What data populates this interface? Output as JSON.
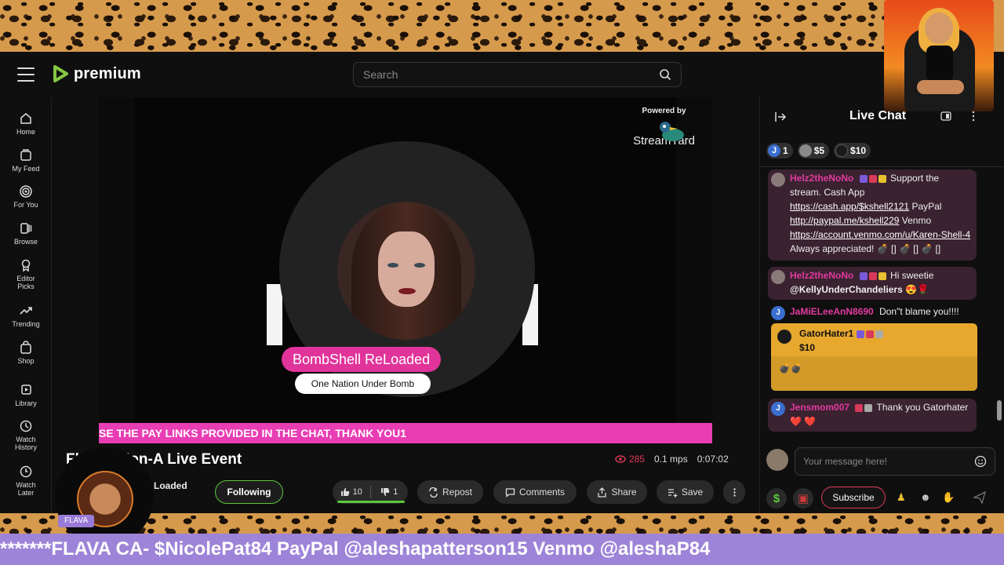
{
  "app": {
    "logo_text": "premium"
  },
  "search": {
    "placeholder": "Search"
  },
  "sidebar": {
    "items": [
      {
        "label": "Home",
        "icon": "home-icon"
      },
      {
        "label": "My Feed",
        "icon": "feed-icon"
      },
      {
        "label": "For You",
        "icon": "target-icon"
      },
      {
        "label": "Browse",
        "icon": "browse-icon"
      },
      {
        "label": "Editor Picks",
        "icon": "award-icon"
      },
      {
        "label": "Trending",
        "icon": "trending-icon"
      },
      {
        "label": "Shop",
        "icon": "shop-icon"
      },
      {
        "label": "Library",
        "icon": "library-icon"
      },
      {
        "label": "Watch History",
        "icon": "history-icon"
      },
      {
        "label": "Watch Later",
        "icon": "clock-icon"
      }
    ]
  },
  "video": {
    "powered_by": "Powered by",
    "powered_brand": "StreamYard",
    "name_pill": "BombShell ReLoaded",
    "sub_pill": "One Nation Under Bomb",
    "ticker": "SE THE PAY LINKS PROVIDED IN THE CHAT, THANK YOU1"
  },
  "info": {
    "title": "Fl      bsession-A Live Event",
    "viewers": "285",
    "bitrate": "0.1 mps",
    "duration": "0:07:02",
    "channel": "Loaded",
    "follow_label": "Following",
    "likes": "10",
    "dislikes": "1",
    "repost_label": "Repost",
    "comments_label": "Comments",
    "share_label": "Share",
    "save_label": "Save"
  },
  "chat": {
    "title": "Live Chat",
    "chips": [
      {
        "text": "1",
        "color": "#3a6fd0",
        "initial": "J"
      },
      {
        "text": "$5",
        "color": "#8a8a8a",
        "initial": ""
      },
      {
        "text": "$10",
        "color": "#1a1a1a",
        "initial": ""
      }
    ],
    "messages": [
      {
        "user": "Helz2theNoNo",
        "pre": " Support the stream. Cash App ",
        "link1": "https://cash.app/$kshell2121",
        "mid1": " PayPal ",
        "link2": "http://paypal.me/kshell229",
        "mid2": " Venmo ",
        "link3": "https://account.venmo.com/u/Karen-Shell-4",
        "post": " Always appreciated! 💣 [] 💣 [] 💣 []"
      },
      {
        "user": "Helz2theNoNo",
        "text": " Hi sweetie ",
        "mention": "@KellyUnderChandeliers",
        "emoji": " 😍🌹"
      },
      {
        "user": "JaMiELeeAnN8690",
        "text": "Don\"t blame you!!!!",
        "initial": "J"
      },
      {
        "user": "GatorHater1",
        "amount": "$10",
        "text": "💣💣"
      },
      {
        "user": "Jensmom007",
        "text": " Thank you Gatorhater ❤️ ❤️",
        "initial": "J"
      }
    ],
    "input_placeholder": "Your message here!",
    "subscribe_label": "Subscribe"
  },
  "overlay": {
    "flava_tag": "FLAVA",
    "marquee": "*******FLAVA CA- $NicolePat84 PayPal @aleshapatterson15 Venmo @aleshaP84"
  },
  "colors": {
    "accent_green": "#5ac93a",
    "pink": "#e93db4",
    "chat_user": "#e23aa0",
    "tip_gold": "#e8a82e",
    "marquee": "#9d84d8"
  }
}
